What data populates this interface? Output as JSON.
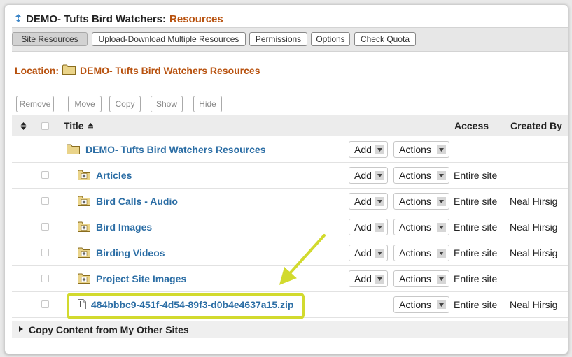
{
  "page": {
    "title_prefix": "DEMO- Tufts Bird Watchers:",
    "title_suffix": "Resources"
  },
  "toolbar": [
    {
      "label": "Site Resources",
      "active": true
    },
    {
      "label": "Upload-Download Multiple Resources",
      "active": false
    },
    {
      "label": "Permissions",
      "active": false
    },
    {
      "label": "Options",
      "active": false
    },
    {
      "label": "Check Quota",
      "active": false
    }
  ],
  "location": {
    "label": "Location:",
    "path": "DEMO- Tufts Bird Watchers Resources"
  },
  "action_buttons": [
    "Remove",
    "Move",
    "Copy",
    "Show",
    "Hide"
  ],
  "table": {
    "columns": {
      "title": "Title",
      "access": "Access",
      "created_by": "Created By"
    },
    "root": {
      "name": "DEMO- Tufts Bird Watchers Resources",
      "add": "Add",
      "actions": "Actions"
    },
    "rows": [
      {
        "name": "Articles",
        "type": "folder",
        "add": "Add",
        "actions": "Actions",
        "access": "Entire site",
        "created_by": ""
      },
      {
        "name": "Bird Calls - Audio",
        "type": "folder",
        "add": "Add",
        "actions": "Actions",
        "access": "Entire site",
        "created_by": "Neal Hirsig"
      },
      {
        "name": "Bird Images",
        "type": "folder",
        "add": "Add",
        "actions": "Actions",
        "access": "Entire site",
        "created_by": "Neal Hirsig"
      },
      {
        "name": "Birding Videos",
        "type": "folder",
        "add": "Add",
        "actions": "Actions",
        "access": "Entire site",
        "created_by": "Neal Hirsig"
      },
      {
        "name": "Project Site Images",
        "type": "folder",
        "add": "Add",
        "actions": "Actions",
        "access": "Entire site",
        "created_by": ""
      },
      {
        "name": "484bbbc9-451f-4d54-89f3-d0b4e4637a15.zip",
        "type": "file",
        "add": "",
        "actions": "Actions",
        "access": "Entire site",
        "created_by": "Neal Hirsig"
      }
    ]
  },
  "footer": {
    "label": "Copy Content from My Other Sites"
  },
  "icons": {
    "title_icon": "swap-arrows-icon",
    "folder": "folder-icon",
    "collapsed_folder": "folder-plus-icon",
    "file": "zip-file-icon",
    "sort": "sort-ascending-icon",
    "dropdown": "chevron-down-icon",
    "expand": "triangle-right-icon"
  },
  "colors": {
    "brand_orange": "#b8520f",
    "link_blue": "#2c6ea5",
    "highlight": "#d2da2e"
  }
}
